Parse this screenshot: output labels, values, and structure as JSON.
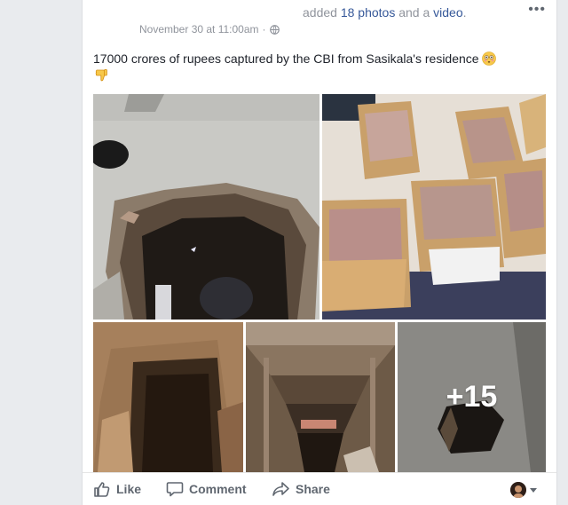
{
  "header": {
    "action_text": "added",
    "photos_link": "18 photos",
    "and_text": " and a ",
    "video_link": "video",
    "end_text": "."
  },
  "meta": {
    "timestamp": "November 30 at 11:00am",
    "separator": "·"
  },
  "post": {
    "text": "17000 crores of rupees captured by the CBI from Sasikala's residence"
  },
  "photos": {
    "extra_count": "+15"
  },
  "actions": {
    "like_label": "Like",
    "comment_label": "Comment",
    "share_label": "Share"
  },
  "icons": {
    "more": "more-options-icon",
    "privacy": "globe-icon",
    "like": "thumbs-up-icon",
    "comment": "speech-bubble-icon",
    "share": "share-arrow-icon"
  },
  "colors": {
    "link": "#365899",
    "meta": "#90949c",
    "action": "#606770"
  }
}
